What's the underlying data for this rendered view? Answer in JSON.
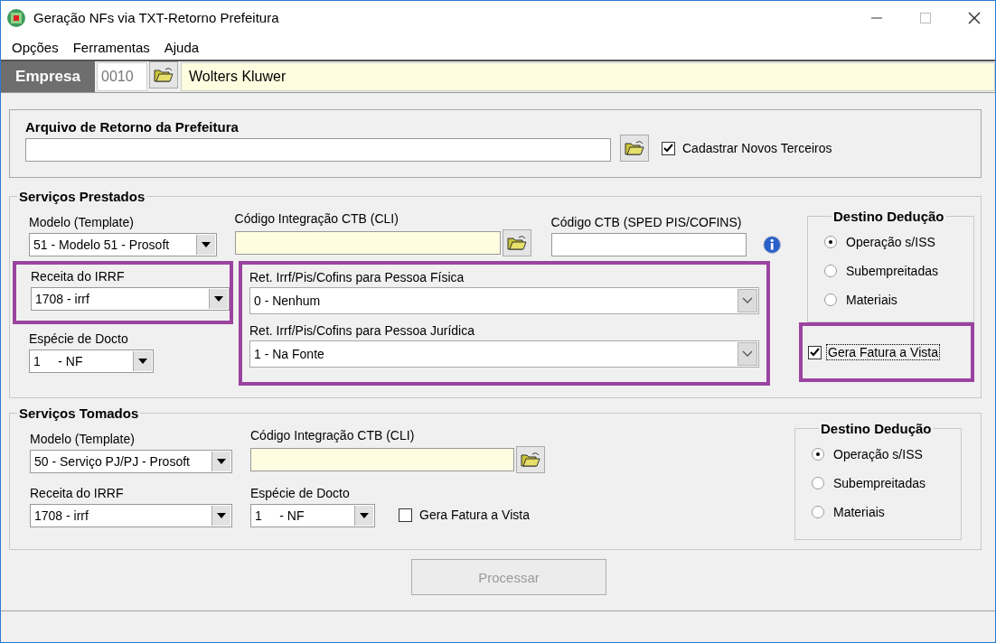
{
  "window": {
    "title": "Geração NFs via TXT-Retorno Prefeitura"
  },
  "menu": [
    "Opções",
    "Ferramentas",
    "Ajuda"
  ],
  "empresa": {
    "label": "Empresa",
    "code": "0010",
    "name": "Wolters Kluwer"
  },
  "arquivo": {
    "title": "Arquivo de Retorno da Prefeitura",
    "checkbox": {
      "label": "Cadastrar Novos Terceiros",
      "checked": true
    }
  },
  "servicos_prestados": {
    "legend": "Serviços Prestados",
    "modelo": {
      "label": "Modelo (Template)",
      "value": "51 - Modelo 51 - Prosoft"
    },
    "cli": {
      "label": "Código Integração CTB (CLI)"
    },
    "ctb": {
      "label": "Código CTB (SPED PIS/COFINS)"
    },
    "receita": {
      "label": "Receita do IRRF",
      "value": "1708 - irrf",
      "highlighted": true
    },
    "especie": {
      "label": "Espécie de Docto",
      "value": "1     - NF"
    },
    "retencao": {
      "highlighted": true,
      "fields": [
        {
          "label": "Ret. Irrf/Pis/Cofins para Pessoa Física",
          "value": "0 - Nenhum"
        },
        {
          "label": "Ret. Irrf/Pis/Cofins para Pessoa Jurídica",
          "value": "1 - Na Fonte"
        }
      ]
    },
    "destino": {
      "legend": "Destino Dedução",
      "options": [
        {
          "label": "Operação s/ISS",
          "selected": true
        },
        {
          "label": "Subempreitadas",
          "selected": false
        },
        {
          "label": "Materiais",
          "selected": false
        }
      ]
    },
    "gera_fatura": {
      "label": "Gera Fatura a Vista",
      "checked": true,
      "highlighted": true
    }
  },
  "servicos_tomados": {
    "legend": "Serviços Tomados",
    "modelo": {
      "label": "Modelo (Template)",
      "value": "50 - Serviço PJ/PJ - Prosoft"
    },
    "cli": {
      "label": "Código Integração CTB (CLI)"
    },
    "receita": {
      "label": "Receita do IRRF",
      "value": "1708 - irrf"
    },
    "especie": {
      "label": "Espécie de Docto",
      "value": "1     - NF"
    },
    "gera_fatura": {
      "label": "Gera Fatura a Vista",
      "checked": false
    },
    "destino": {
      "legend": "Destino Dedução",
      "options": [
        {
          "label": "Operação s/ISS",
          "selected": true
        },
        {
          "label": "Subempreitadas",
          "selected": false
        },
        {
          "label": "Materiais",
          "selected": false
        }
      ]
    }
  },
  "process_button": {
    "label": "Processar",
    "disabled": true
  }
}
